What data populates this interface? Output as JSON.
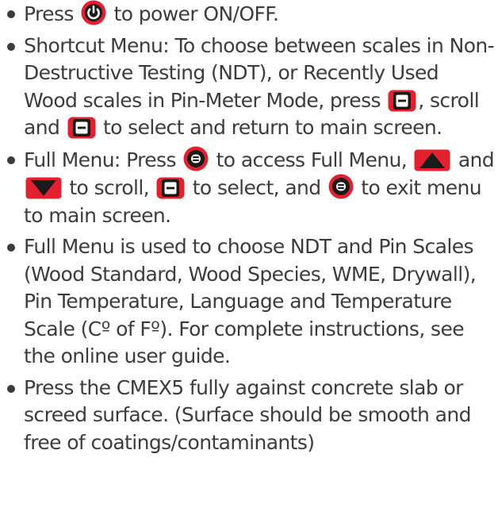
{
  "instructions": {
    "items": [
      {
        "parts": [
          {
            "t": "Press "
          },
          {
            "icon": "power-button-icon"
          },
          {
            "t": " to power ON/OFF."
          }
        ]
      },
      {
        "parts": [
          {
            "t": "Shortcut Menu: To choose between scales in Non-Destructive Testing (NDT), or Recently Used Wood scales in Pin-Meter Mode, press "
          },
          {
            "icon": "select-button-icon"
          },
          {
            "t": ", scroll and "
          },
          {
            "icon": "select-button-icon"
          },
          {
            "t": " to select and return to main screen."
          }
        ]
      },
      {
        "parts": [
          {
            "t": "Full Menu: Press "
          },
          {
            "icon": "menu-button-icon"
          },
          {
            "t": " to access Full Menu, "
          },
          {
            "icon": "up-button-icon"
          },
          {
            "t": " and "
          },
          {
            "icon": "down-button-icon"
          },
          {
            "t": " to scroll, "
          },
          {
            "icon": "select-button-icon"
          },
          {
            "t": " to select, and "
          },
          {
            "icon": "menu-button-icon"
          },
          {
            "t": " to exit menu to main screen."
          }
        ]
      },
      {
        "parts": [
          {
            "t": "Full Menu is used to choose NDT and Pin Scales (Wood Standard, Wood Species, WME, Drywall), Pin Temperature, Language and Temperature Scale (Cº of Fº). For complete instructions, see the online user guide."
          }
        ]
      },
      {
        "parts": [
          {
            "t": "Press the CMEX5 fully against concrete slab or screed surface. (Surface should be smooth and free of coatings/contaminants)"
          }
        ]
      }
    ]
  },
  "colors": {
    "text": "#3c3c3c",
    "icon_red": "#e5202e",
    "icon_dark": "#1a1a1a",
    "icon_white": "#ffffff"
  }
}
